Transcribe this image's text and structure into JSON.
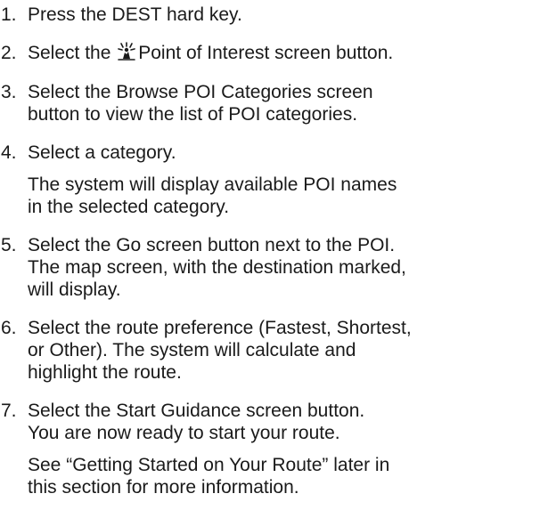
{
  "steps": [
    {
      "number": "1.",
      "lines": [
        "Press the DEST hard key."
      ]
    },
    {
      "number": "2.",
      "before_icon": "Select the",
      "icon": "point-of-interest-icon",
      "after_icon": "Point of Interest screen button."
    },
    {
      "number": "3.",
      "lines": [
        "Select the Browse POI Categories screen",
        "button to view the list of POI categories."
      ]
    },
    {
      "number": "4.",
      "lines": [
        "Select a category."
      ],
      "note_lines": [
        "The system will display available POI names",
        "in the selected category."
      ]
    },
    {
      "number": "5.",
      "lines": [
        "Select the Go screen button next to the POI.",
        "The map screen, with the destination marked,",
        "will display."
      ]
    },
    {
      "number": "6.",
      "lines": [
        "Select the route preference (Fastest, Shortest,",
        "or Other). The system will calculate and",
        "highlight the route."
      ]
    },
    {
      "number": "7.",
      "lines": [
        "Select the Start Guidance screen button.",
        "You are now ready to start your route."
      ],
      "note_lines": [
        "See “Getting Started on Your Route” later in",
        "this section for more information."
      ]
    }
  ]
}
